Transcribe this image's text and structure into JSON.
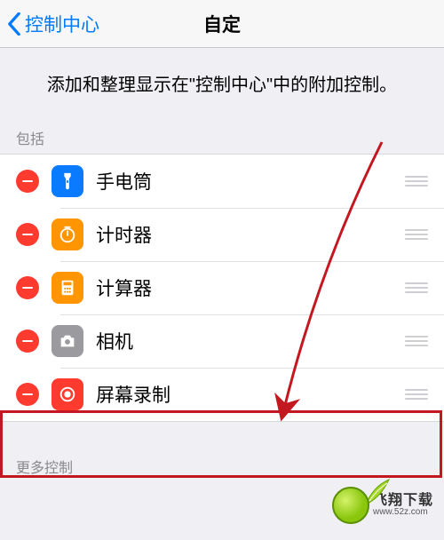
{
  "nav": {
    "back_label": "控制中心",
    "title": "自定"
  },
  "description": "添加和整理显示在\"控制中心\"中的附加控制。",
  "included_label": "包括",
  "more_label": "更多控制",
  "items": [
    {
      "label": "手电筒"
    },
    {
      "label": "计时器"
    },
    {
      "label": "计算器"
    },
    {
      "label": "相机"
    },
    {
      "label": "屏幕录制"
    }
  ],
  "watermark": {
    "name": "飞翔下载",
    "url": "www.52z.com"
  }
}
